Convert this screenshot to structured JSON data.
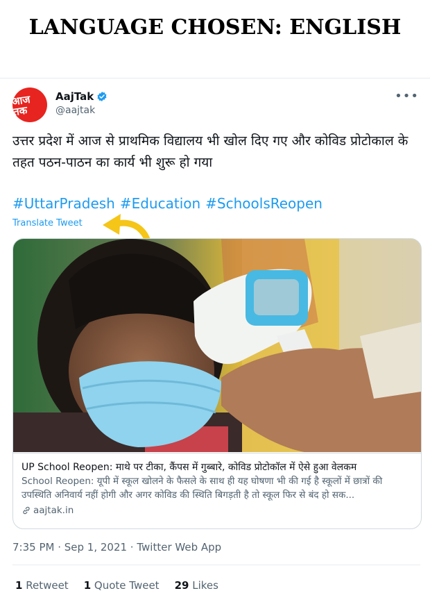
{
  "banner": "LANGUAGE CHOSEN: ENGLISH",
  "account": {
    "avatar_text": "आज तक",
    "name": "AajTak",
    "handle": "@aajtak",
    "brand_color": "#e7241f",
    "verified_color": "#1d9bf0"
  },
  "tweet": {
    "text": "उत्तर प्रदेश में आज से प्राथमिक विद्यालय भी खोल दिए गए और कोविड प्रोटोकाल के तहत पठन-पाठन का कार्य भी शुरू हो गया",
    "hashtags": [
      "#UttarPradesh",
      "#Education",
      "#SchoolsReopen"
    ],
    "translate_label": "Translate Tweet",
    "more_icon": "more-icon"
  },
  "card": {
    "title": "UP School Reopen: माथे पर टीका, कैंपस में गुब्बारे, कोविड प्रोटोकॉल में ऐसे हुआ वेलकम",
    "description": "School Reopen: यूपी में स्कूल खोलने के फैसले के साथ ही यह घोषणा भी की गई है स्कूलों में छात्रों की उपस्थिति अनिवार्य नहीं होगी और अगर कोविड की स्थिति बिगड़ती है तो स्कूल फिर से बंद हो सक...",
    "domain": "aajtak.in"
  },
  "meta": "7:35 PM · Sep 1, 2021 · Twitter Web App",
  "stats": {
    "retweets_count": "1",
    "retweets_label": "Retweet",
    "quotes_count": "1",
    "quotes_label": "Quote Tweet",
    "likes_count": "29",
    "likes_label": "Likes"
  },
  "annotation_color": "#f5c518"
}
